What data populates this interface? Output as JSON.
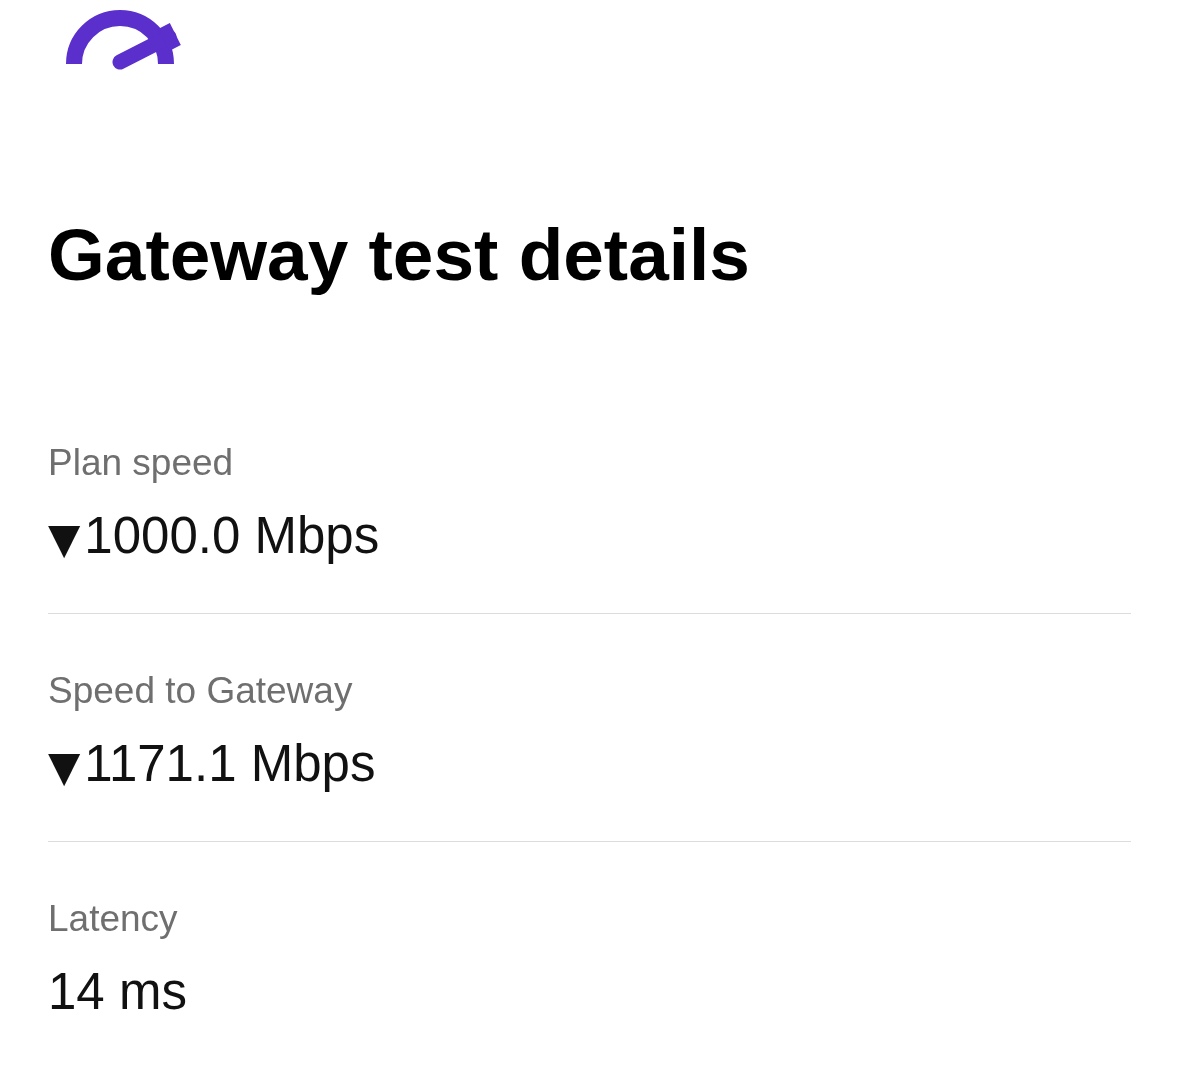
{
  "title": "Gateway test details",
  "details": [
    {
      "label": "Plan speed",
      "icon": "▼",
      "value": "1000.0 Mbps"
    },
    {
      "label": "Speed to Gateway",
      "icon": "▼",
      "value": "1171.1 Mbps"
    },
    {
      "label": "Latency",
      "value": "14 ms"
    }
  ]
}
